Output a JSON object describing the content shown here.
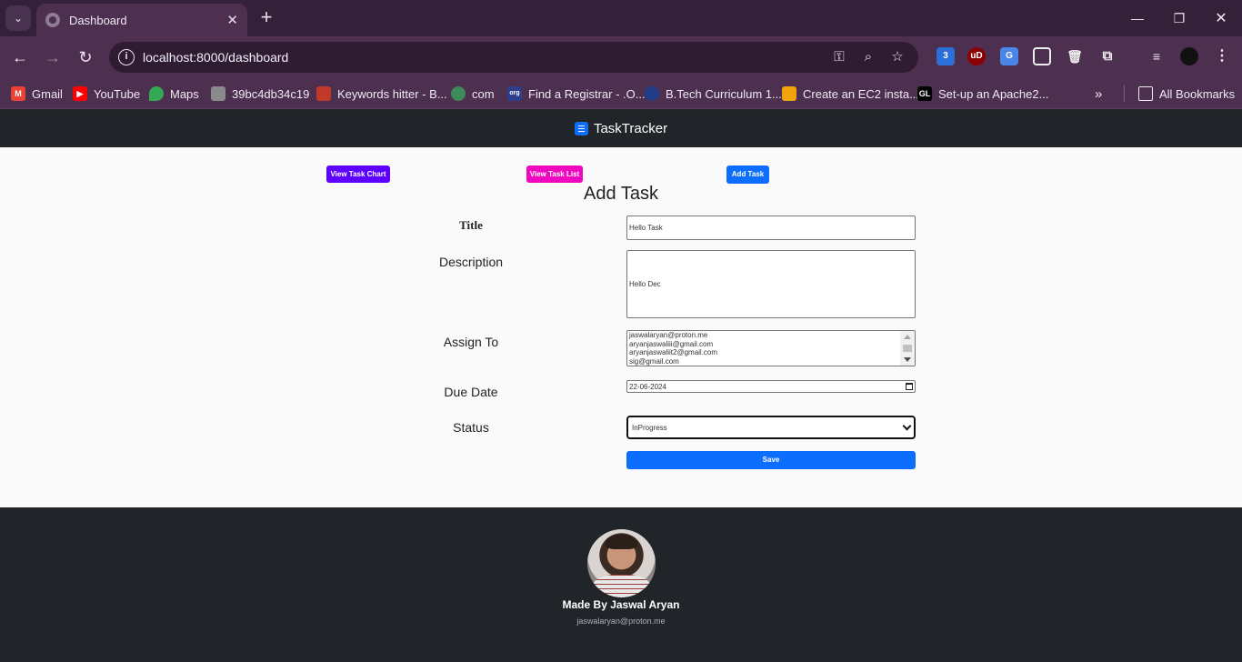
{
  "browser": {
    "tab_title": "Dashboard",
    "url": "localhost:8000/dashboard",
    "ext_badge": "3",
    "bookmarks": [
      {
        "label": "Gmail",
        "icon": "gmail-icon",
        "color": "#ea4335"
      },
      {
        "label": "YouTube",
        "icon": "youtube-icon",
        "color": "#ff0000"
      },
      {
        "label": "Maps",
        "icon": "maps-icon",
        "color": "#34a853"
      },
      {
        "label": "39bc4db34c19",
        "icon": "page-icon",
        "color": "#8a8a8a"
      },
      {
        "label": "Keywords hitter - B...",
        "icon": "keywords-icon",
        "color": "#c0392b"
      },
      {
        "label": "com",
        "icon": "globe-icon",
        "color": "#3d8b5a"
      },
      {
        "label": "Find a Registrar - .O...",
        "icon": "org-icon",
        "color": "#2c3e8c"
      },
      {
        "label": "B.Tech Curriculum 1...",
        "icon": "university-icon",
        "color": "#1f3c88"
      },
      {
        "label": "Create an EC2 insta...",
        "icon": "aws-icon",
        "color": "#f0a30a"
      },
      {
        "label": "Set-up an Apache2...",
        "icon": "gl-icon",
        "color": "#000000"
      }
    ],
    "all_bookmarks": "All Bookmarks"
  },
  "app": {
    "brand": "TaskTracker",
    "nav_buttons": {
      "chart": "View Task Chart",
      "list": "View Task List",
      "add": "Add Task"
    },
    "colors": {
      "chart_btn": "#5d00ff",
      "list_btn": "#f008c0",
      "add_btn": "#0d6efd",
      "save_btn": "#0d6efd"
    }
  },
  "form": {
    "heading": "Add Task",
    "title_label": "Title",
    "title_value": "Hello Task",
    "description_label": "Description",
    "description_value": "Hello Dec",
    "assign_label": "Assign To",
    "assign_options": [
      "jaswalaryan@proton.me",
      "aryanjaswaliii@gmail.com",
      "aryanjaswaliit2@gmail.com",
      "sig@gmail.com"
    ],
    "due_label": "Due Date",
    "due_value": "22-06-2024",
    "status_label": "Status",
    "status_value": "InProgress",
    "save_label": "Save"
  },
  "footer": {
    "name": "Made By Jaswal Aryan",
    "email": "jaswalaryan@proton.me"
  }
}
